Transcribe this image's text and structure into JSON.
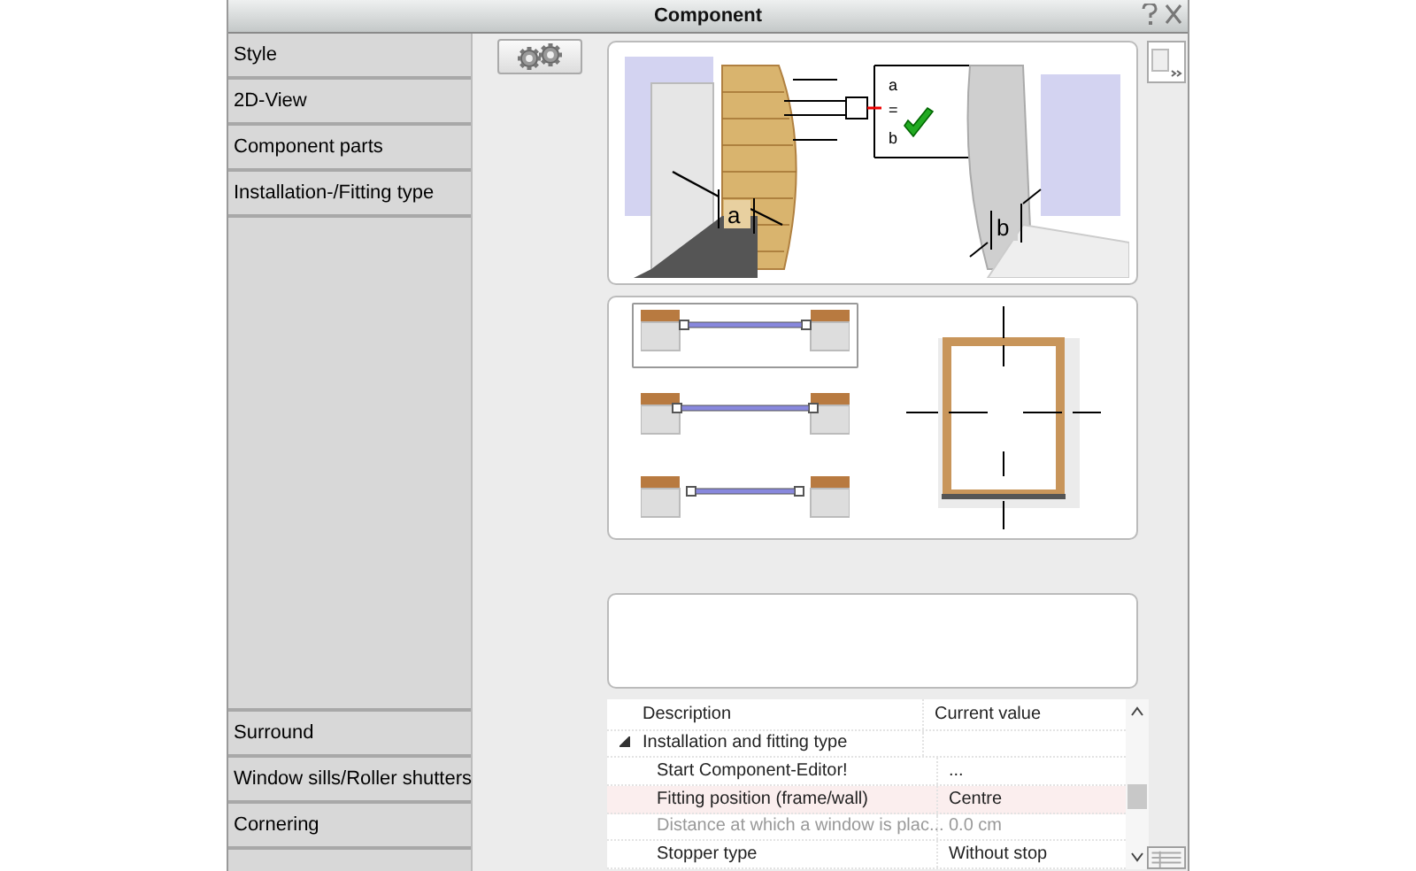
{
  "window": {
    "title": "Component"
  },
  "sidebar": {
    "top_items": [
      {
        "label": "Style"
      },
      {
        "label": "2D-View"
      },
      {
        "label": "Component parts"
      },
      {
        "label": "Installation-/Fitting type"
      }
    ],
    "bottom_items": [
      {
        "label": "Surround"
      },
      {
        "label": "Window sills/Roller shutters"
      },
      {
        "label": "Cornering"
      }
    ]
  },
  "illustration": {
    "labels": [
      "a",
      "=",
      "b",
      "a",
      "b"
    ]
  },
  "fitting_options": [
    {
      "selected": true
    },
    {
      "selected": false
    },
    {
      "selected": false
    }
  ],
  "properties": {
    "columns": [
      "Description",
      "Current value"
    ],
    "rows": [
      {
        "kind": "group",
        "expanded": true,
        "label": "Installation and fitting type"
      },
      {
        "kind": "item",
        "label": "Start Component-Editor!",
        "value": "...",
        "selected": false,
        "disabled": false
      },
      {
        "kind": "item",
        "label": "Fitting position (frame/wall)",
        "value": "Centre",
        "selected": true,
        "disabled": false
      },
      {
        "kind": "item",
        "label": "Distance at which a window is plac...",
        "value": "0.0 cm",
        "selected": false,
        "disabled": true
      },
      {
        "kind": "item",
        "label": "Stopper type",
        "value": "Without stop",
        "selected": false,
        "disabled": false
      }
    ]
  }
}
